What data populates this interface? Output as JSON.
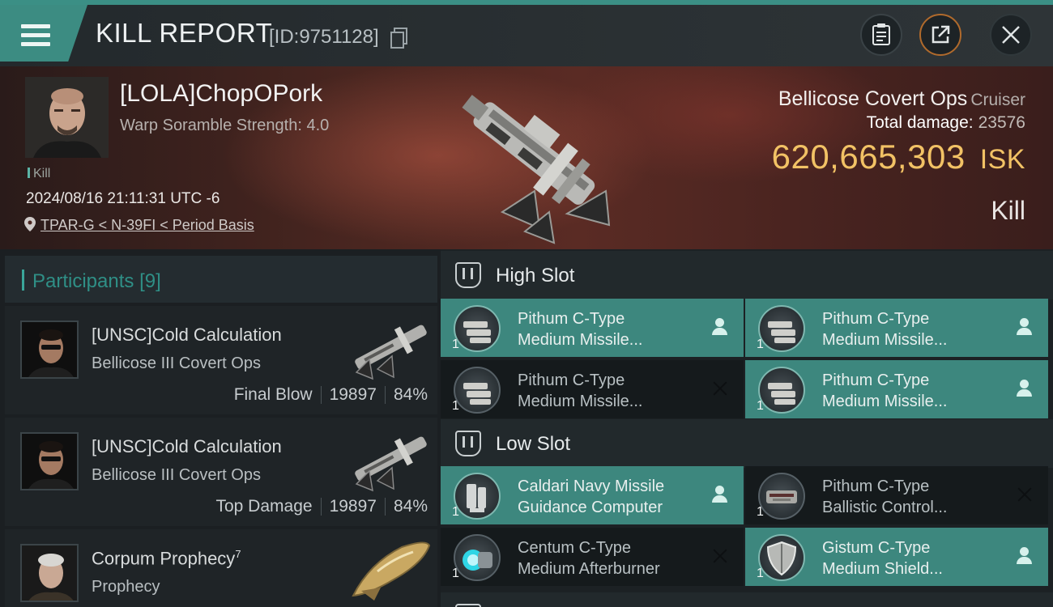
{
  "header": {
    "title": "KILL REPORT",
    "id_text": "[ID:9751128]",
    "icons": {
      "menu": "menu-icon",
      "copy": "copy-icon",
      "clipboard": "clipboard-icon",
      "share": "share-icon",
      "close": "close-icon"
    },
    "accent": "#3b8f85"
  },
  "victim": {
    "name": "[LOLA]ChopOPork",
    "scramble": "Warp Soramble Strength: 4.0",
    "kill_tag": "Kill",
    "timestamp": "2024/08/16 21:11:31 UTC -6",
    "location": "TPAR-G < N-39FI < Period Basis",
    "ship_name": "Bellicose Covert Ops",
    "ship_class": "Cruiser",
    "total_damage_label": "Total damage:",
    "total_damage": "23576",
    "isk_value": "620,665,303",
    "isk_unit": "ISK",
    "result": "Kill",
    "isk_color": "#f2c265"
  },
  "participants": {
    "label": "Participants",
    "count": "[9]",
    "rows": [
      {
        "name": "[UNSC]Cold Calculation",
        "ship": "Bellicose III Covert Ops",
        "role": "Final Blow",
        "damage": "19897",
        "percent": "84%"
      },
      {
        "name": "[UNSC]Cold Calculation",
        "ship": "Bellicose III Covert Ops",
        "role": "Top Damage",
        "damage": "19897",
        "percent": "84%"
      },
      {
        "name": "Corpum Prophecy",
        "name_sup": "7",
        "ship": "Prophecy"
      }
    ]
  },
  "fitting": {
    "high_slot": {
      "label": "High Slot",
      "modules": [
        {
          "line1": "Pithum C-Type",
          "line2": "Medium Missile...",
          "qty": "1",
          "state": "pilot-icon"
        },
        {
          "line1": "Pithum C-Type",
          "line2": "Medium Missile...",
          "qty": "1",
          "state": "pilot-icon"
        },
        {
          "line1": "Pithum C-Type",
          "line2": "Medium Missile...",
          "qty": "1",
          "state": "x-icon"
        },
        {
          "line1": "Pithum C-Type",
          "line2": "Medium Missile...",
          "qty": "1",
          "state": "pilot-icon"
        }
      ]
    },
    "low_slot": {
      "label": "Low Slot",
      "modules": [
        {
          "line1": "Caldari Navy Missile",
          "line2": "Guidance Computer",
          "qty": "1",
          "state": "pilot-icon"
        },
        {
          "line1": "Pithum C-Type",
          "line2": "Ballistic Control...",
          "qty": "1",
          "state": "x-icon"
        },
        {
          "line1": "Centum C-Type",
          "line2": "Medium Afterburner",
          "qty": "1",
          "state": "x-icon"
        },
        {
          "line1": "Gistum C-Type",
          "line2": "Medium Shield...",
          "qty": "1",
          "state": "pilot-icon"
        }
      ]
    },
    "active_color": "#3d877e"
  }
}
